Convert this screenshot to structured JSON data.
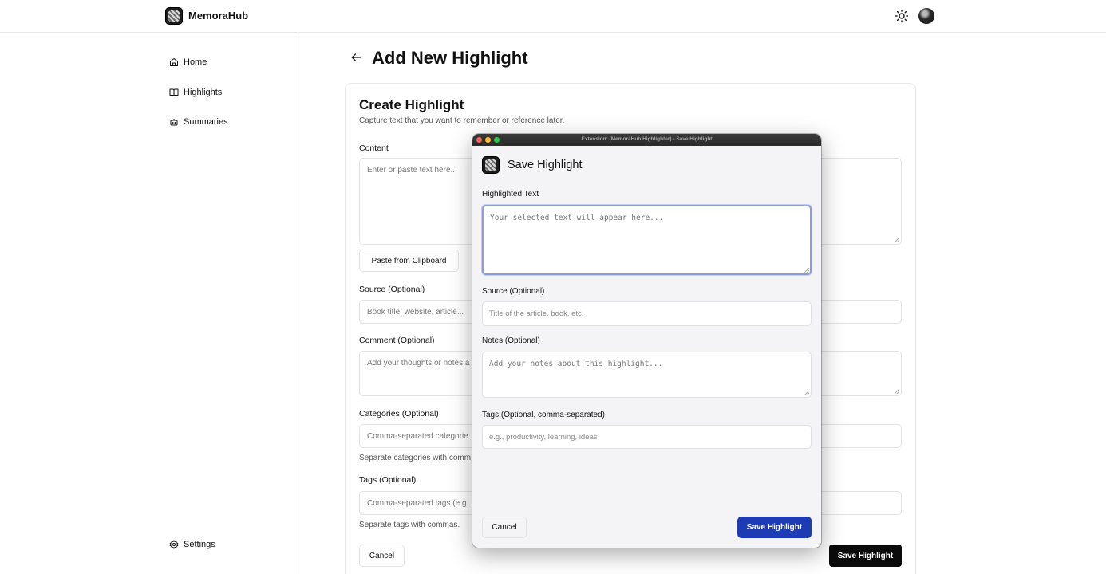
{
  "header": {
    "brand": "MemoraHub",
    "logo_icon": "memorahub-logo-icon",
    "theme_icon": "sun-icon",
    "avatar_icon": "user-avatar"
  },
  "sidebar": {
    "items": [
      {
        "label": "Home",
        "icon": "home-icon"
      },
      {
        "label": "Highlights",
        "icon": "book-open-icon"
      },
      {
        "label": "Summaries",
        "icon": "bot-icon"
      }
    ],
    "settings": {
      "label": "Settings",
      "icon": "gear-icon"
    }
  },
  "main": {
    "page_title": "Add New Highlight",
    "back_icon": "arrow-left-icon",
    "card": {
      "title": "Create Highlight",
      "subtitle": "Capture text that you want to remember or reference later.",
      "content_label": "Content",
      "content_placeholder": "Enter or paste text here...",
      "paste_button": "Paste from Clipboard",
      "source_label": "Source (Optional)",
      "source_placeholder": "Book title, website, article...",
      "comment_label": "Comment (Optional)",
      "comment_placeholder": "Add your thoughts or notes a",
      "categories_label": "Categories (Optional)",
      "categories_placeholder": "Comma-separated categorie",
      "categories_hint": "Separate categories with comm",
      "tags_label": "Tags (Optional)",
      "tags_placeholder": "Comma-separated tags (e.g.",
      "tags_hint": "Separate tags with commas.",
      "cancel_button": "Cancel",
      "save_button": "Save Highlight"
    }
  },
  "popup": {
    "window_title": "Extension: (MemoraHub Highlighter) - Save Highlight",
    "heading": "Save Highlight",
    "highlighted_label": "Highlighted Text",
    "highlighted_placeholder": "Your selected text will appear here...",
    "source_label": "Source (Optional)",
    "source_placeholder": "Title of the article, book, etc.",
    "notes_label": "Notes (Optional)",
    "notes_placeholder": "Add your notes about this highlight...",
    "tags_label": "Tags (Optional, comma-separated)",
    "tags_placeholder": "e.g., productivity, learning, ideas",
    "cancel_button": "Cancel",
    "save_button": "Save Highlight",
    "accent_color": "#1d3bb2",
    "traffic_lights": [
      "#fe5f57",
      "#febc2e",
      "#28c840"
    ]
  }
}
